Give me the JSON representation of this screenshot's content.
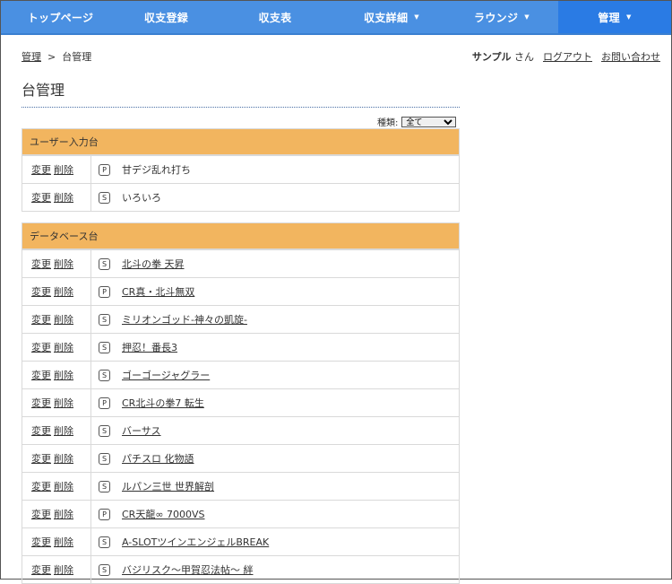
{
  "nav": [
    {
      "label": "トップページ",
      "caret": false,
      "active": false
    },
    {
      "label": "収支登録",
      "caret": false,
      "active": false
    },
    {
      "label": "収支表",
      "caret": false,
      "active": false
    },
    {
      "label": "収支詳細",
      "caret": true,
      "active": false
    },
    {
      "label": "ラウンジ",
      "caret": true,
      "active": false
    },
    {
      "label": "管理",
      "caret": true,
      "active": true
    }
  ],
  "breadcrumb": {
    "root": "管理",
    "separator": ">",
    "current": "台管理"
  },
  "user": {
    "name": "サンプル",
    "honorific": "さん",
    "logout": "ログアウト",
    "contact": "お問い合わせ"
  },
  "page_title": "台管理",
  "filter": {
    "label": "種類:",
    "selected": "全て"
  },
  "actions": {
    "edit": "変更",
    "delete": "削除"
  },
  "sections": [
    {
      "title": "ユーザー入力台",
      "linked": false,
      "items": [
        {
          "type": "P",
          "name": "甘デジ乱れ打ち"
        },
        {
          "type": "S",
          "name": "いろいろ"
        }
      ]
    },
    {
      "title": "データベース台",
      "linked": true,
      "items": [
        {
          "type": "S",
          "name": "北斗の拳 天昇"
        },
        {
          "type": "P",
          "name": "CR真・北斗無双"
        },
        {
          "type": "S",
          "name": "ミリオンゴッド-神々の凱旋-"
        },
        {
          "type": "S",
          "name": "押忍！番長3"
        },
        {
          "type": "S",
          "name": "ゴーゴージャグラー"
        },
        {
          "type": "P",
          "name": "CR北斗の拳7 転生"
        },
        {
          "type": "S",
          "name": "バーサス"
        },
        {
          "type": "S",
          "name": "パチスロ 化物語"
        },
        {
          "type": "S",
          "name": "ルパン三世 世界解剖"
        },
        {
          "type": "P",
          "name": "CR天龍∞ 7000VS"
        },
        {
          "type": "S",
          "name": "A-SLOTツインエンジェルBREAK"
        },
        {
          "type": "S",
          "name": "バジリスク～甲賀忍法帖～ 絆"
        }
      ]
    }
  ]
}
